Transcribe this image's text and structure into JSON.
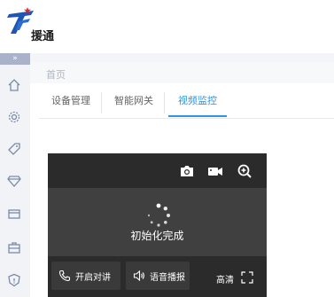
{
  "app": {
    "logo_text": "援通"
  },
  "sidebar": {
    "toggle_label": "»",
    "icons": [
      "home-icon",
      "gear-icon",
      "tag-icon",
      "diamond-icon",
      "screen-icon",
      "briefcase-icon",
      "shield-icon"
    ]
  },
  "breadcrumb": {
    "home": "首页"
  },
  "tabs": [
    {
      "label": "设备管理"
    },
    {
      "label": "智能网关"
    },
    {
      "label": "视频监控"
    }
  ],
  "player": {
    "status_text": "初始化完成",
    "top_icons": [
      "camera-icon",
      "video-record-icon",
      "zoom-in-icon"
    ],
    "talk_label": "开启对讲",
    "broadcast_label": "语音播报",
    "quality_label": "高清"
  },
  "colors": {
    "accent": "#2f93e6",
    "player_bg": "#404040",
    "player_bar": "#2b2b2b",
    "logo_blue": "#1f56b3",
    "logo_red": "#d9282f"
  }
}
